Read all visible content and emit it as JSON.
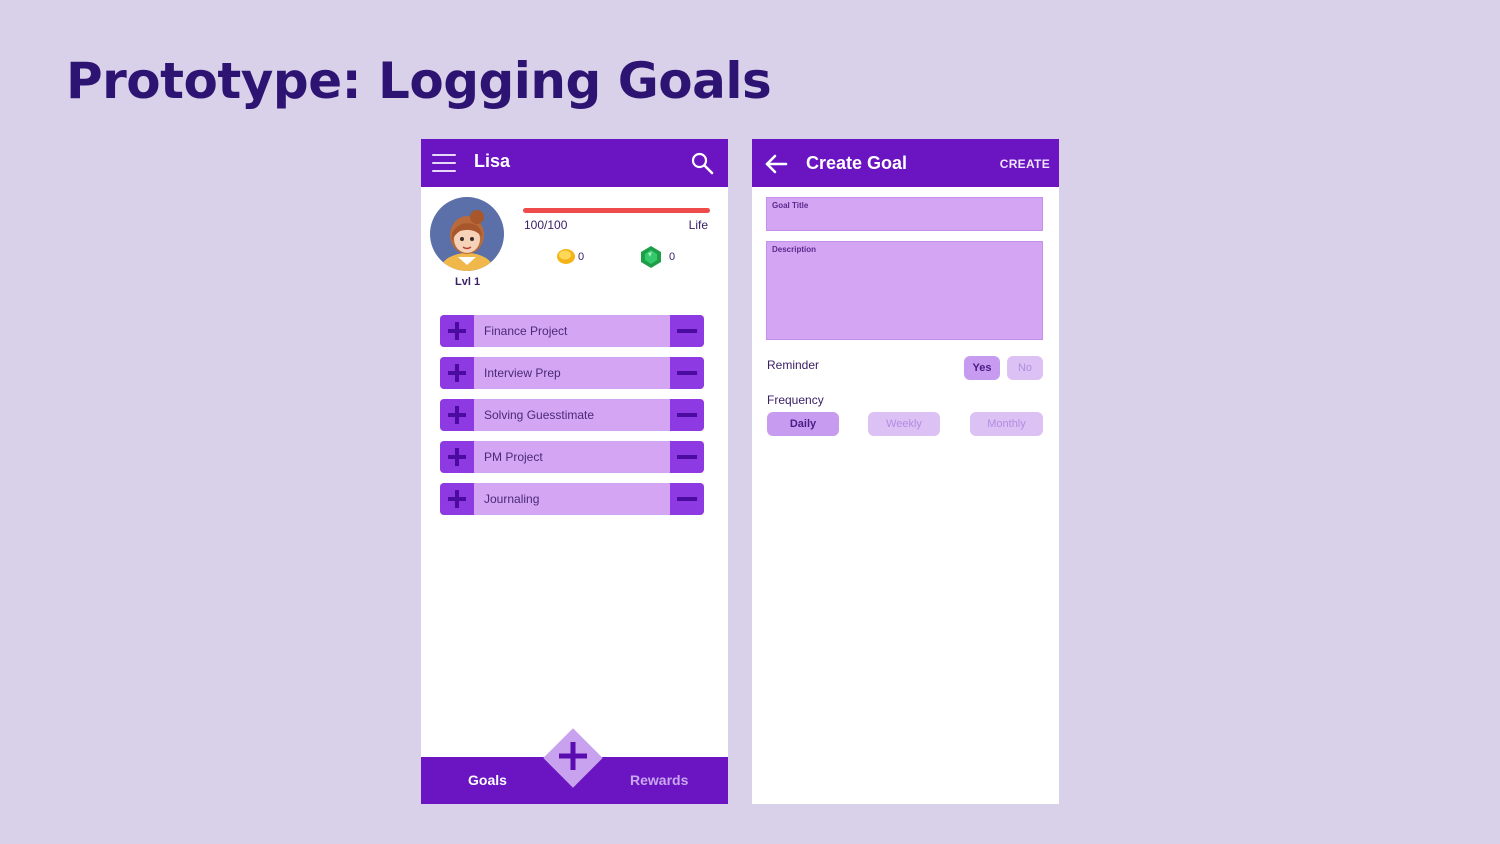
{
  "slide": {
    "title": "Prototype: Logging Goals"
  },
  "home_screen": {
    "header": {
      "title": "Lisa"
    },
    "profile": {
      "level": "Lvl 1",
      "life_value": "100/100",
      "life_label": "Life",
      "life_fraction": 1.0,
      "coins": "0",
      "gems": "0"
    },
    "goals": [
      {
        "label": "Finance Project"
      },
      {
        "label": "Interview Prep"
      },
      {
        "label": "Solving Guesstimate"
      },
      {
        "label": "PM Project"
      },
      {
        "label": "Journaling"
      }
    ],
    "bottom_nav": {
      "goals_label": "Goals",
      "rewards_label": "Rewards"
    }
  },
  "create_screen": {
    "header": {
      "title": "Create Goal",
      "action": "CREATE"
    },
    "fields": {
      "goal_title_label": "Goal Title",
      "description_label": "Description"
    },
    "reminder": {
      "label": "Reminder",
      "yes": "Yes",
      "no": "No",
      "selected": "Yes"
    },
    "frequency": {
      "label": "Frequency",
      "daily": "Daily",
      "weekly": "Weekly",
      "monthly": "Monthly",
      "selected": "Daily"
    }
  },
  "colors": {
    "page_background": "#d9d0ea",
    "title_text": "#2e1472",
    "app_bar": "#6a14c2",
    "goal_item": "#d3a5f2",
    "goal_button": "#8d3ae3",
    "life_bar": "#ef4b4b"
  },
  "icons": {
    "menu": "hamburger-menu-icon",
    "search": "search-icon",
    "back": "back-arrow-icon",
    "coin": "coin-icon",
    "gem": "gem-icon",
    "add": "plus-icon",
    "remove": "minus-icon"
  }
}
